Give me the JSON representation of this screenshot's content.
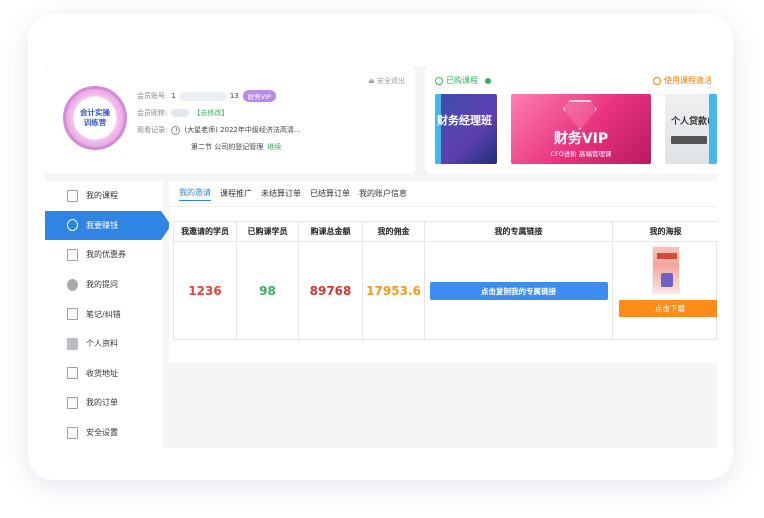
{
  "profile": {
    "avatar_text": "会计实操 训练营",
    "account_label": "会员账号:",
    "account_prefix": "1",
    "account_suffix": "13",
    "vip_badge": "财务VIP",
    "nickname_label": "会员昵称:",
    "edit_label": "【去修改】",
    "history_label": "观看记录:",
    "history_value": "(大星老师) 2022年中级经济法高清...",
    "lesson": "第二节 公司的登记管理",
    "continue_label": "继续",
    "logout_label": "安全退出"
  },
  "courses": {
    "purchased_tab": "已购课程",
    "activate_tab": "使用课程激活",
    "thumb1_title": "财务经理班",
    "thumb2_title": "财务VIP",
    "thumb2_subtitle": "CFO进阶  高端管理课",
    "thumb3_title": "个人贷款(初"
  },
  "sidebar": {
    "items": [
      {
        "label": "我的课程",
        "icon": "book-icon"
      },
      {
        "label": "我要赚钱",
        "icon": "coin-icon",
        "active": true
      },
      {
        "label": "我的优惠券",
        "icon": "coupon-icon"
      },
      {
        "label": "我的提问",
        "icon": "question-icon"
      },
      {
        "label": "笔记/纠错",
        "icon": "note-icon"
      },
      {
        "label": "个人资料",
        "icon": "profile-icon"
      },
      {
        "label": "收货地址",
        "icon": "address-icon"
      },
      {
        "label": "我的订单",
        "icon": "order-icon"
      },
      {
        "label": "安全设置",
        "icon": "security-icon"
      }
    ]
  },
  "tabs": [
    "我的邀请",
    "课程推广",
    "未结算订单",
    "已结算订单",
    "我的账户信息"
  ],
  "table": {
    "headers": [
      "我邀请的学员",
      "已购课学员",
      "购课总金额",
      "我的佣金",
      "我的专属链接",
      "我的海报"
    ],
    "invited": "1236",
    "purchased": "98",
    "total_amount": "89768",
    "commission": "17953.6",
    "copy_button": "点击复制我的专属链接",
    "download_button": "点击下载"
  },
  "colors": {
    "accent_blue": "#2f84e4",
    "invited_red": "#e5443a",
    "purchased_green": "#2fb45a",
    "amount_red": "#d9342b",
    "commission_orange": "#f39a1e",
    "download_orange": "#ff8c1a"
  }
}
